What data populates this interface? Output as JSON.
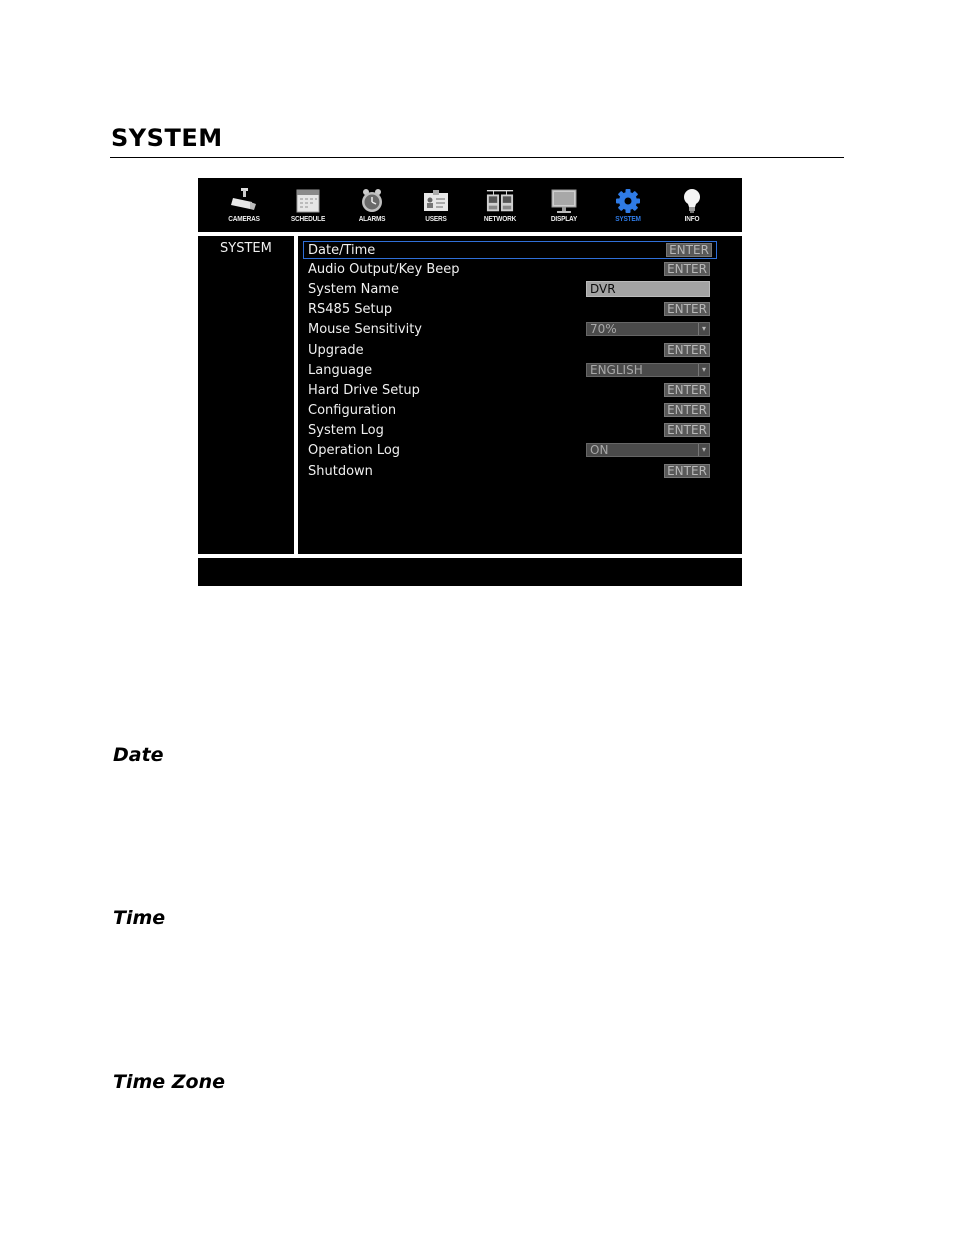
{
  "page": {
    "title": "SYSTEM",
    "sections": [
      "Date",
      "Time",
      "Time Zone"
    ]
  },
  "dvr": {
    "tabs": [
      {
        "label": "CAMERAS",
        "icon": "camera-icon",
        "active": false
      },
      {
        "label": "SCHEDULE",
        "icon": "calendar-icon",
        "active": false
      },
      {
        "label": "ALARMS",
        "icon": "alarm-clock-icon",
        "active": false
      },
      {
        "label": "USERS",
        "icon": "id-card-icon",
        "active": false
      },
      {
        "label": "NETWORK",
        "icon": "network-icon",
        "active": false
      },
      {
        "label": "DISPLAY",
        "icon": "monitor-icon",
        "active": false
      },
      {
        "label": "SYSTEM",
        "icon": "gear-icon",
        "active": true
      },
      {
        "label": "INFO",
        "icon": "lightbulb-icon",
        "active": false
      }
    ],
    "side_label": "SYSTEM",
    "rows": [
      {
        "label": "Date/Time",
        "control": "button",
        "value": "ENTER",
        "selected": true
      },
      {
        "label": "Audio Output/Key Beep",
        "control": "button",
        "value": "ENTER"
      },
      {
        "label": "System Name",
        "control": "text",
        "value": "DVR"
      },
      {
        "label": "RS485 Setup",
        "control": "button",
        "value": "ENTER"
      },
      {
        "label": "Mouse Sensitivity",
        "control": "dropdown",
        "value": "70%"
      },
      {
        "label": "Upgrade",
        "control": "button",
        "value": "ENTER"
      },
      {
        "label": "Language",
        "control": "dropdown",
        "value": "ENGLISH"
      },
      {
        "label": "Hard Drive Setup",
        "control": "button",
        "value": "ENTER"
      },
      {
        "label": "Configuration",
        "control": "button",
        "value": "ENTER"
      },
      {
        "label": "System Log",
        "control": "button",
        "value": "ENTER"
      },
      {
        "label": "Operation Log",
        "control": "dropdown",
        "value": "ON"
      },
      {
        "label": "Shutdown",
        "control": "button",
        "value": "ENTER"
      }
    ],
    "colors": {
      "accent": "#2f7be6",
      "selection_border": "#2f6fd9"
    }
  }
}
